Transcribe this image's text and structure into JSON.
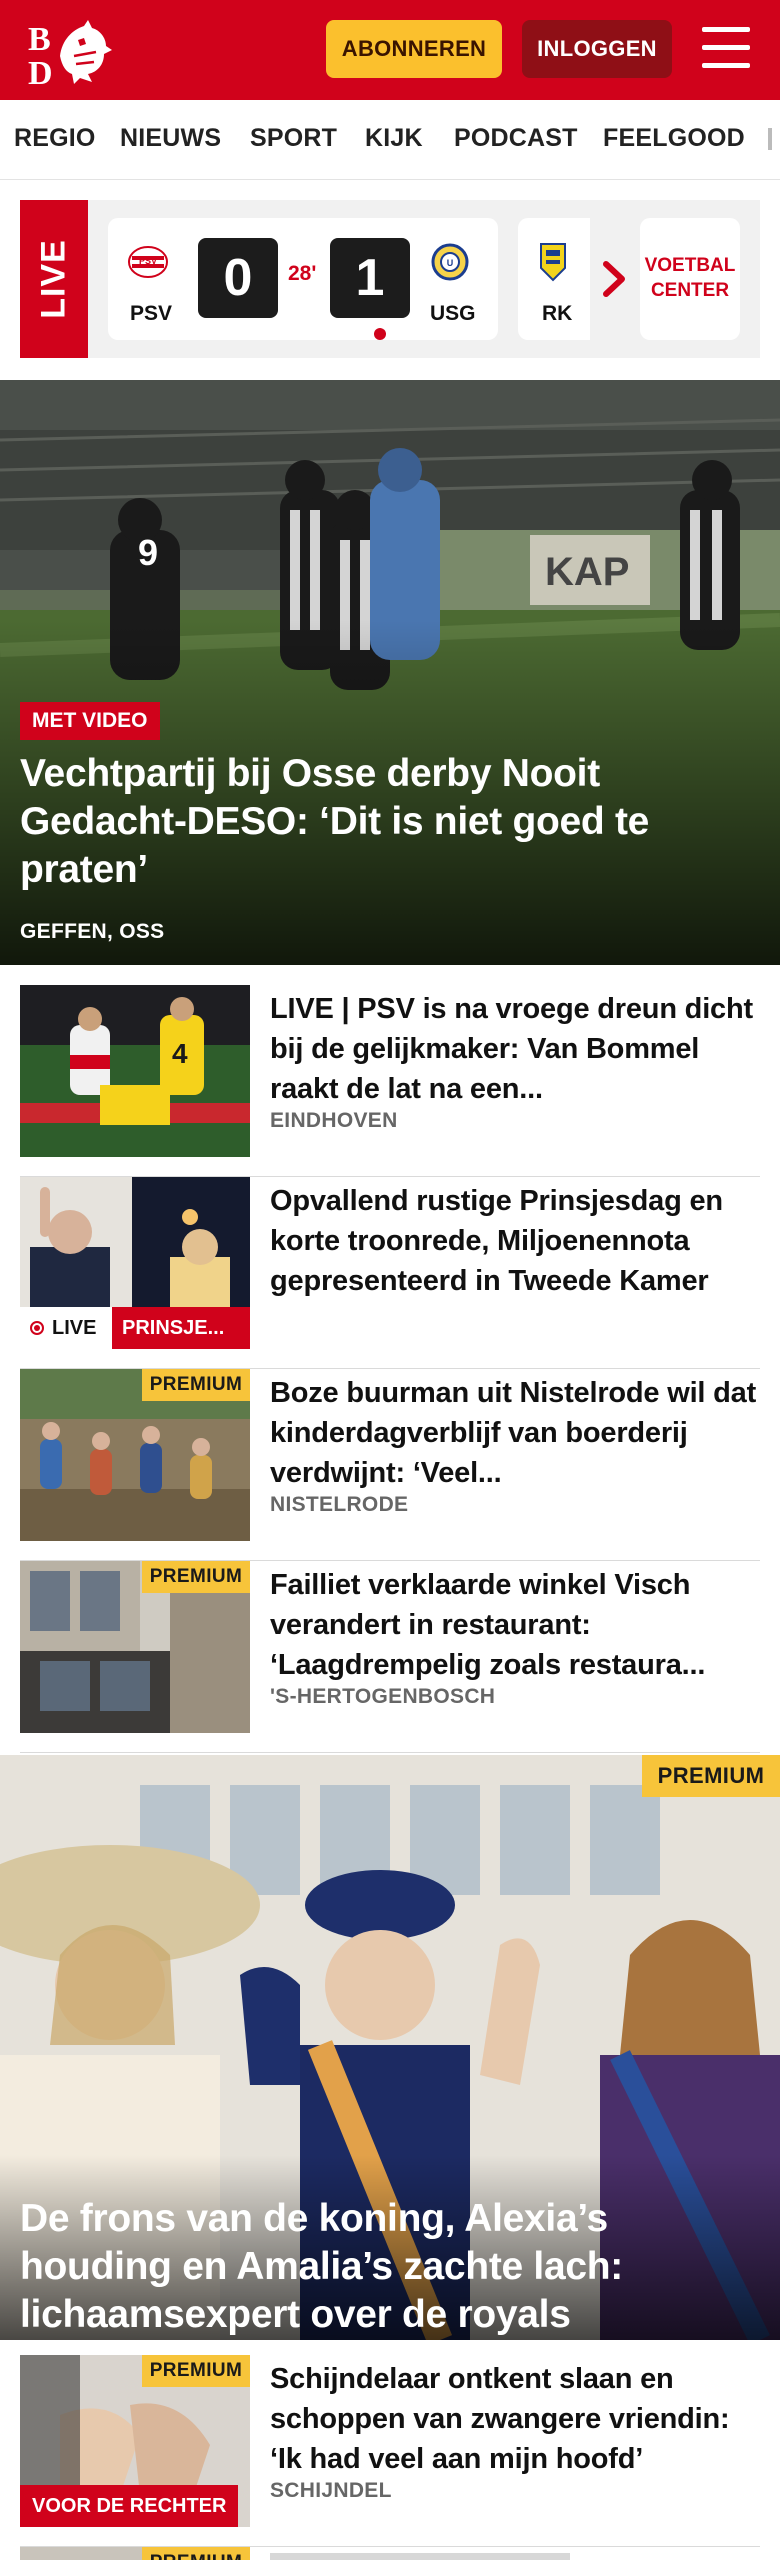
{
  "header": {
    "subscribe_label": "ABONNEREN",
    "login_label": "INLOGGEN",
    "brand_color": "#d0021b",
    "subscribe_color": "#fbc02d"
  },
  "nav": {
    "items": [
      "REGIO",
      "NIEUWS",
      "SPORT",
      "KIJK",
      "PODCAST",
      "FEELGOOD"
    ]
  },
  "live_bar": {
    "live_label": "LIVE",
    "match": {
      "home_team": "PSV",
      "home_score": "0",
      "minute": "28'",
      "away_score": "1",
      "away_team": "USG"
    },
    "next_team": "RK",
    "center_label": "VOETBAL CENTER"
  },
  "hero": {
    "badge": "MET VIDEO",
    "title": "Vechtpartij bij Osse derby Nooit Gedacht-DESO: ‘Dit is niet goed te praten’",
    "location": "GEFFEN, OSS"
  },
  "articles": [
    {
      "title": "LIVE | PSV is na vroege dreun dicht bij de gelijkmaker: Van Bommel raakt de lat na een...",
      "location": "EINDHOVEN"
    },
    {
      "title": "Opvallend rustige Prinsjesdag en korte troonrede, Miljoenennota gepresenteerd in Tweede Kamer",
      "live_label": "LIVE",
      "topic": "PRINSJE..."
    },
    {
      "premium": "PREMIUM",
      "title": "Boze buurman uit Nistelrode wil dat kinderdagverblijf van boerderij verdwijnt: ‘Veel...",
      "location": "NISTELRODE"
    },
    {
      "premium": "PREMIUM",
      "title": "Failliet verklaarde winkel Visch verandert in restaurant: ‘Laagdrempelig zoals restaura...",
      "location": "'S-HERTOGENBOSCH"
    }
  ],
  "royals": {
    "premium": "PREMIUM",
    "title": "De frons van de koning, Alexia’s houding en Amalia’s zachte lach: lichaamsexpert over de royals"
  },
  "bottom_article": {
    "premium": "PREMIUM",
    "topic": "VOOR DE RECHTER",
    "title": "Schijndelaar ontkent slaan en schoppen van zwangere vriendin: ‘Ik had veel aan mijn hoofd’",
    "location": "SCHIJNDEL"
  },
  "peek_article": {
    "premium": "PREMIUM"
  }
}
